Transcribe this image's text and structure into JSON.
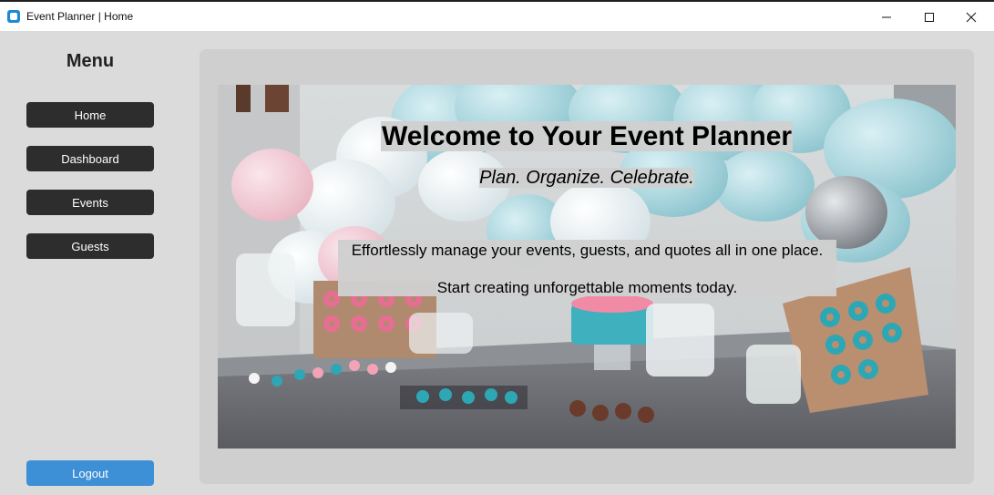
{
  "window": {
    "title": "Event Planner | Home",
    "icons": {
      "app": "app-icon",
      "minimize": "minimize-icon",
      "maximize": "maximize-icon",
      "close": "close-icon"
    }
  },
  "sidebar": {
    "menu_title": "Menu",
    "items": [
      {
        "label": "Home"
      },
      {
        "label": "Dashboard"
      },
      {
        "label": "Events"
      },
      {
        "label": "Guests"
      }
    ],
    "logout_label": "Logout"
  },
  "hero": {
    "title": "Welcome to Your Event Planner",
    "subtitle": "Plan. Organize. Celebrate.",
    "description_line1": "Effortlessly manage your events, guests, and quotes all in one place.",
    "description_line2": "Start creating unforgettable moments today.",
    "image": "party-dessert-table-photo"
  },
  "colors": {
    "nav_button": "#2d2d2d",
    "logout_button": "#3d8fd6",
    "panel": "#cfcfcf",
    "background": "#dbdbdb"
  }
}
